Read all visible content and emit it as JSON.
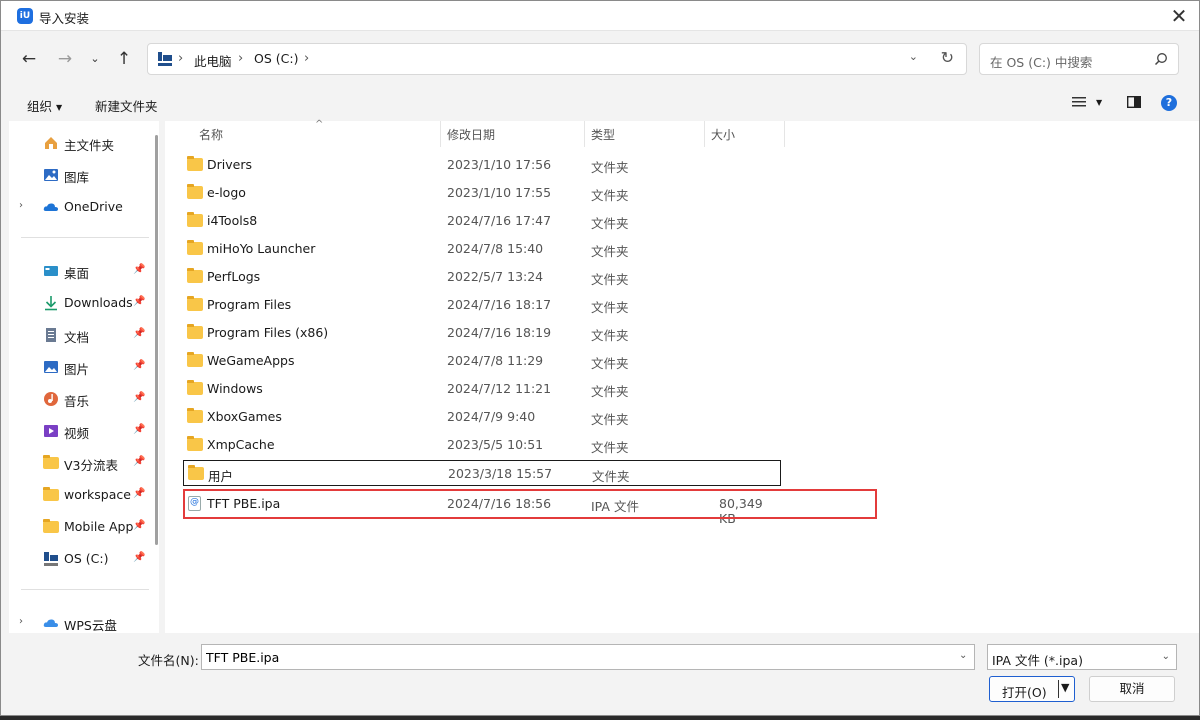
{
  "window": {
    "title": "导入安装",
    "app_logo_text": "iU"
  },
  "address": {
    "crumbs": [
      "此电脑",
      "OS (C:)"
    ],
    "icon": "this-pc-icon"
  },
  "search": {
    "placeholder": "在 OS (C:) 中搜索"
  },
  "toolbar": {
    "organize": "组织",
    "new_folder": "新建文件夹"
  },
  "sidebar": {
    "top": [
      {
        "label": "主文件夹",
        "icon": "home-icon"
      },
      {
        "label": "图库",
        "icon": "gallery-icon"
      },
      {
        "label": "OneDrive",
        "icon": "cloud-icon",
        "expandable": true
      }
    ],
    "pinned": [
      {
        "label": "桌面",
        "icon": "desktop-icon"
      },
      {
        "label": "Downloads",
        "icon": "download-icon"
      },
      {
        "label": "文档",
        "icon": "document-icon"
      },
      {
        "label": "图片",
        "icon": "picture-icon"
      },
      {
        "label": "音乐",
        "icon": "music-icon"
      },
      {
        "label": "视频",
        "icon": "video-icon"
      },
      {
        "label": "V3分流表",
        "icon": "folder-icon"
      },
      {
        "label": "workspace",
        "icon": "folder-icon"
      },
      {
        "label": "Mobile App",
        "icon": "folder-icon"
      },
      {
        "label": "OS (C:)",
        "icon": "drive-icon"
      }
    ],
    "bottom": [
      {
        "label": "WPS云盘",
        "icon": "wps-cloud-icon",
        "expandable": true
      }
    ]
  },
  "columns": {
    "name": "名称",
    "date": "修改日期",
    "type": "类型",
    "size": "大小"
  },
  "files": [
    {
      "name": "Drivers",
      "date": "2023/1/10 17:56",
      "type": "文件夹",
      "size": "",
      "kind": "folder"
    },
    {
      "name": "e-logo",
      "date": "2023/1/10 17:55",
      "type": "文件夹",
      "size": "",
      "kind": "folder"
    },
    {
      "name": "i4Tools8",
      "date": "2024/7/16 17:47",
      "type": "文件夹",
      "size": "",
      "kind": "folder"
    },
    {
      "name": "miHoYo Launcher",
      "date": "2024/7/8 15:40",
      "type": "文件夹",
      "size": "",
      "kind": "folder"
    },
    {
      "name": "PerfLogs",
      "date": "2022/5/7 13:24",
      "type": "文件夹",
      "size": "",
      "kind": "folder"
    },
    {
      "name": "Program Files",
      "date": "2024/7/16 18:17",
      "type": "文件夹",
      "size": "",
      "kind": "folder"
    },
    {
      "name": "Program Files (x86)",
      "date": "2024/7/16 18:19",
      "type": "文件夹",
      "size": "",
      "kind": "folder"
    },
    {
      "name": "WeGameApps",
      "date": "2024/7/8 11:29",
      "type": "文件夹",
      "size": "",
      "kind": "folder"
    },
    {
      "name": "Windows",
      "date": "2024/7/12 11:21",
      "type": "文件夹",
      "size": "",
      "kind": "folder"
    },
    {
      "name": "XboxGames",
      "date": "2024/7/9 9:40",
      "type": "文件夹",
      "size": "",
      "kind": "folder"
    },
    {
      "name": "XmpCache",
      "date": "2023/5/5 10:51",
      "type": "文件夹",
      "size": "",
      "kind": "folder"
    },
    {
      "name": "用户",
      "date": "2023/3/18 15:57",
      "type": "文件夹",
      "size": "",
      "kind": "folder",
      "focused": true
    },
    {
      "name": "TFT PBE.ipa",
      "date": "2024/7/16 18:56",
      "type": "IPA 文件",
      "size": "80,349 KB",
      "kind": "ipa",
      "highlighted": true
    }
  ],
  "bottom": {
    "filename_label": "文件名(N):",
    "filename_value": "TFT PBE.ipa",
    "filetype": "IPA 文件 (*.ipa)",
    "open_label": "打开(O)",
    "cancel_label": "取消"
  },
  "colors": {
    "accent": "#1f5fd0",
    "highlight_red": "#e33b3b",
    "folder": "#f9c648"
  }
}
